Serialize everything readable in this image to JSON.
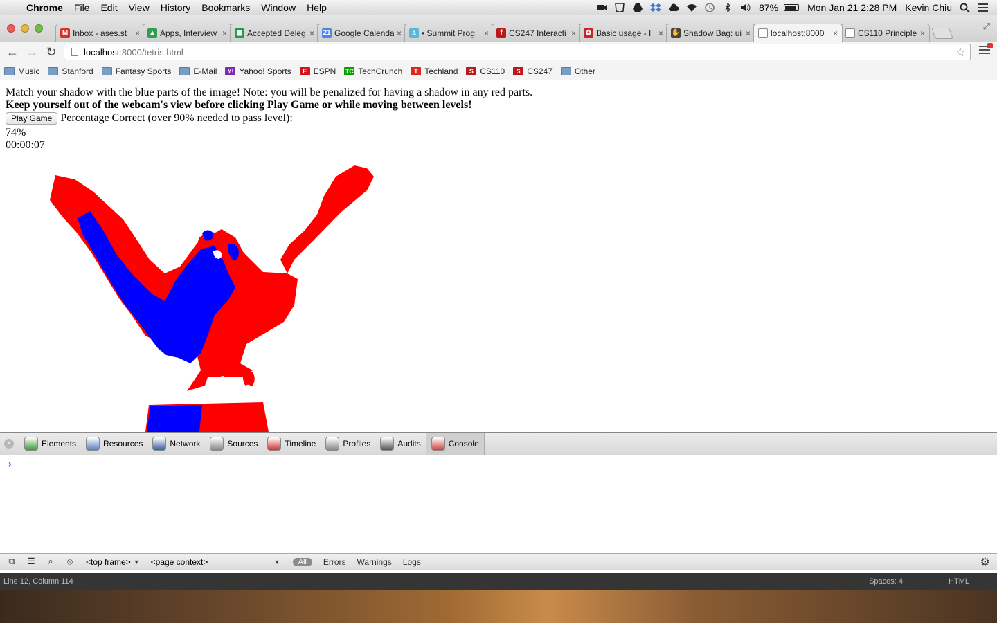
{
  "menubar": {
    "app": "Chrome",
    "menus": [
      "File",
      "Edit",
      "View",
      "History",
      "Bookmarks",
      "Window",
      "Help"
    ],
    "battery": "87%",
    "battery_level": 0.87,
    "clock": "Mon Jan 21  2:28 PM",
    "user": "Kevin Chiu"
  },
  "tabs": [
    {
      "title": "Inbox - ases.st",
      "icon": "gmail-icon",
      "color": "#d93025",
      "glyph": "M"
    },
    {
      "title": "Apps, Interview",
      "icon": "drive-icon",
      "color": "#2e9e4f",
      "glyph": "▲"
    },
    {
      "title": "Accepted Deleg",
      "icon": "sheets-icon",
      "color": "#1a9a52",
      "glyph": "▦"
    },
    {
      "title": "Google Calenda",
      "icon": "calendar-icon",
      "color": "#4a86e8",
      "glyph": "21"
    },
    {
      "title": "• Summit Prog",
      "icon": "asana-icon",
      "color": "#5bb5d9",
      "glyph": "a"
    },
    {
      "title": "CS247 Interacti",
      "icon": "stanford-icon",
      "color": "#b81a1a",
      "glyph": "f"
    },
    {
      "title": "Basic usage - I",
      "icon": "bug-icon",
      "color": "#c0262b",
      "glyph": "✿"
    },
    {
      "title": "Shadow Bag: ui",
      "icon": "figure-icon",
      "color": "#444444",
      "glyph": "✋"
    },
    {
      "title": "localhost:8000",
      "icon": "page-icon",
      "color": "#ffffff",
      "glyph": ""
    },
    {
      "title": "CS110 Principle",
      "icon": "page-icon",
      "color": "#ffffff",
      "glyph": ""
    }
  ],
  "address": {
    "host": "localhost",
    "path": ":8000/tetris.html"
  },
  "bookmarks": [
    {
      "label": "Music",
      "icon": "folder-icon"
    },
    {
      "label": "Stanford",
      "icon": "folder-icon"
    },
    {
      "label": "Fantasy Sports",
      "icon": "folder-icon"
    },
    {
      "label": "E-Mail",
      "icon": "folder-icon"
    },
    {
      "label": "Yahoo! Sports",
      "icon": "yahoo-icon"
    },
    {
      "label": "ESPN",
      "icon": "espn-icon"
    },
    {
      "label": "TechCrunch",
      "icon": "techcrunch-icon"
    },
    {
      "label": "Techland",
      "icon": "techland-icon"
    },
    {
      "label": "CS110",
      "icon": "stanford-icon"
    },
    {
      "label": "CS247",
      "icon": "stanford-icon"
    },
    {
      "label": "Other",
      "icon": "folder-icon"
    }
  ],
  "page": {
    "instruction": "Match your shadow with the blue parts of the image! Note: you will be penalized for having a shadow in any red parts.",
    "warning": "Keep yourself out of the webcam's view before clicking Play Game or while moving between levels!",
    "play_button": "Play Game",
    "score_label": "Percentage Correct (over 90% needed to pass level):",
    "score": "74%",
    "timer": "00:00:07",
    "colors": {
      "target": "#0000ff",
      "penalty": "#ff0000"
    }
  },
  "devtools": {
    "tabs": [
      "Elements",
      "Resources",
      "Network",
      "Sources",
      "Timeline",
      "Profiles",
      "Audits",
      "Console"
    ],
    "active_tab": "Console",
    "prompt": "›",
    "frame_select": "<top frame>",
    "context_select": "<page context>",
    "filters": [
      "All",
      "Errors",
      "Warnings",
      "Logs"
    ]
  },
  "editor_status": {
    "position": "Line 12, Column 114",
    "spaces": "Spaces: 4",
    "syntax": "HTML"
  }
}
